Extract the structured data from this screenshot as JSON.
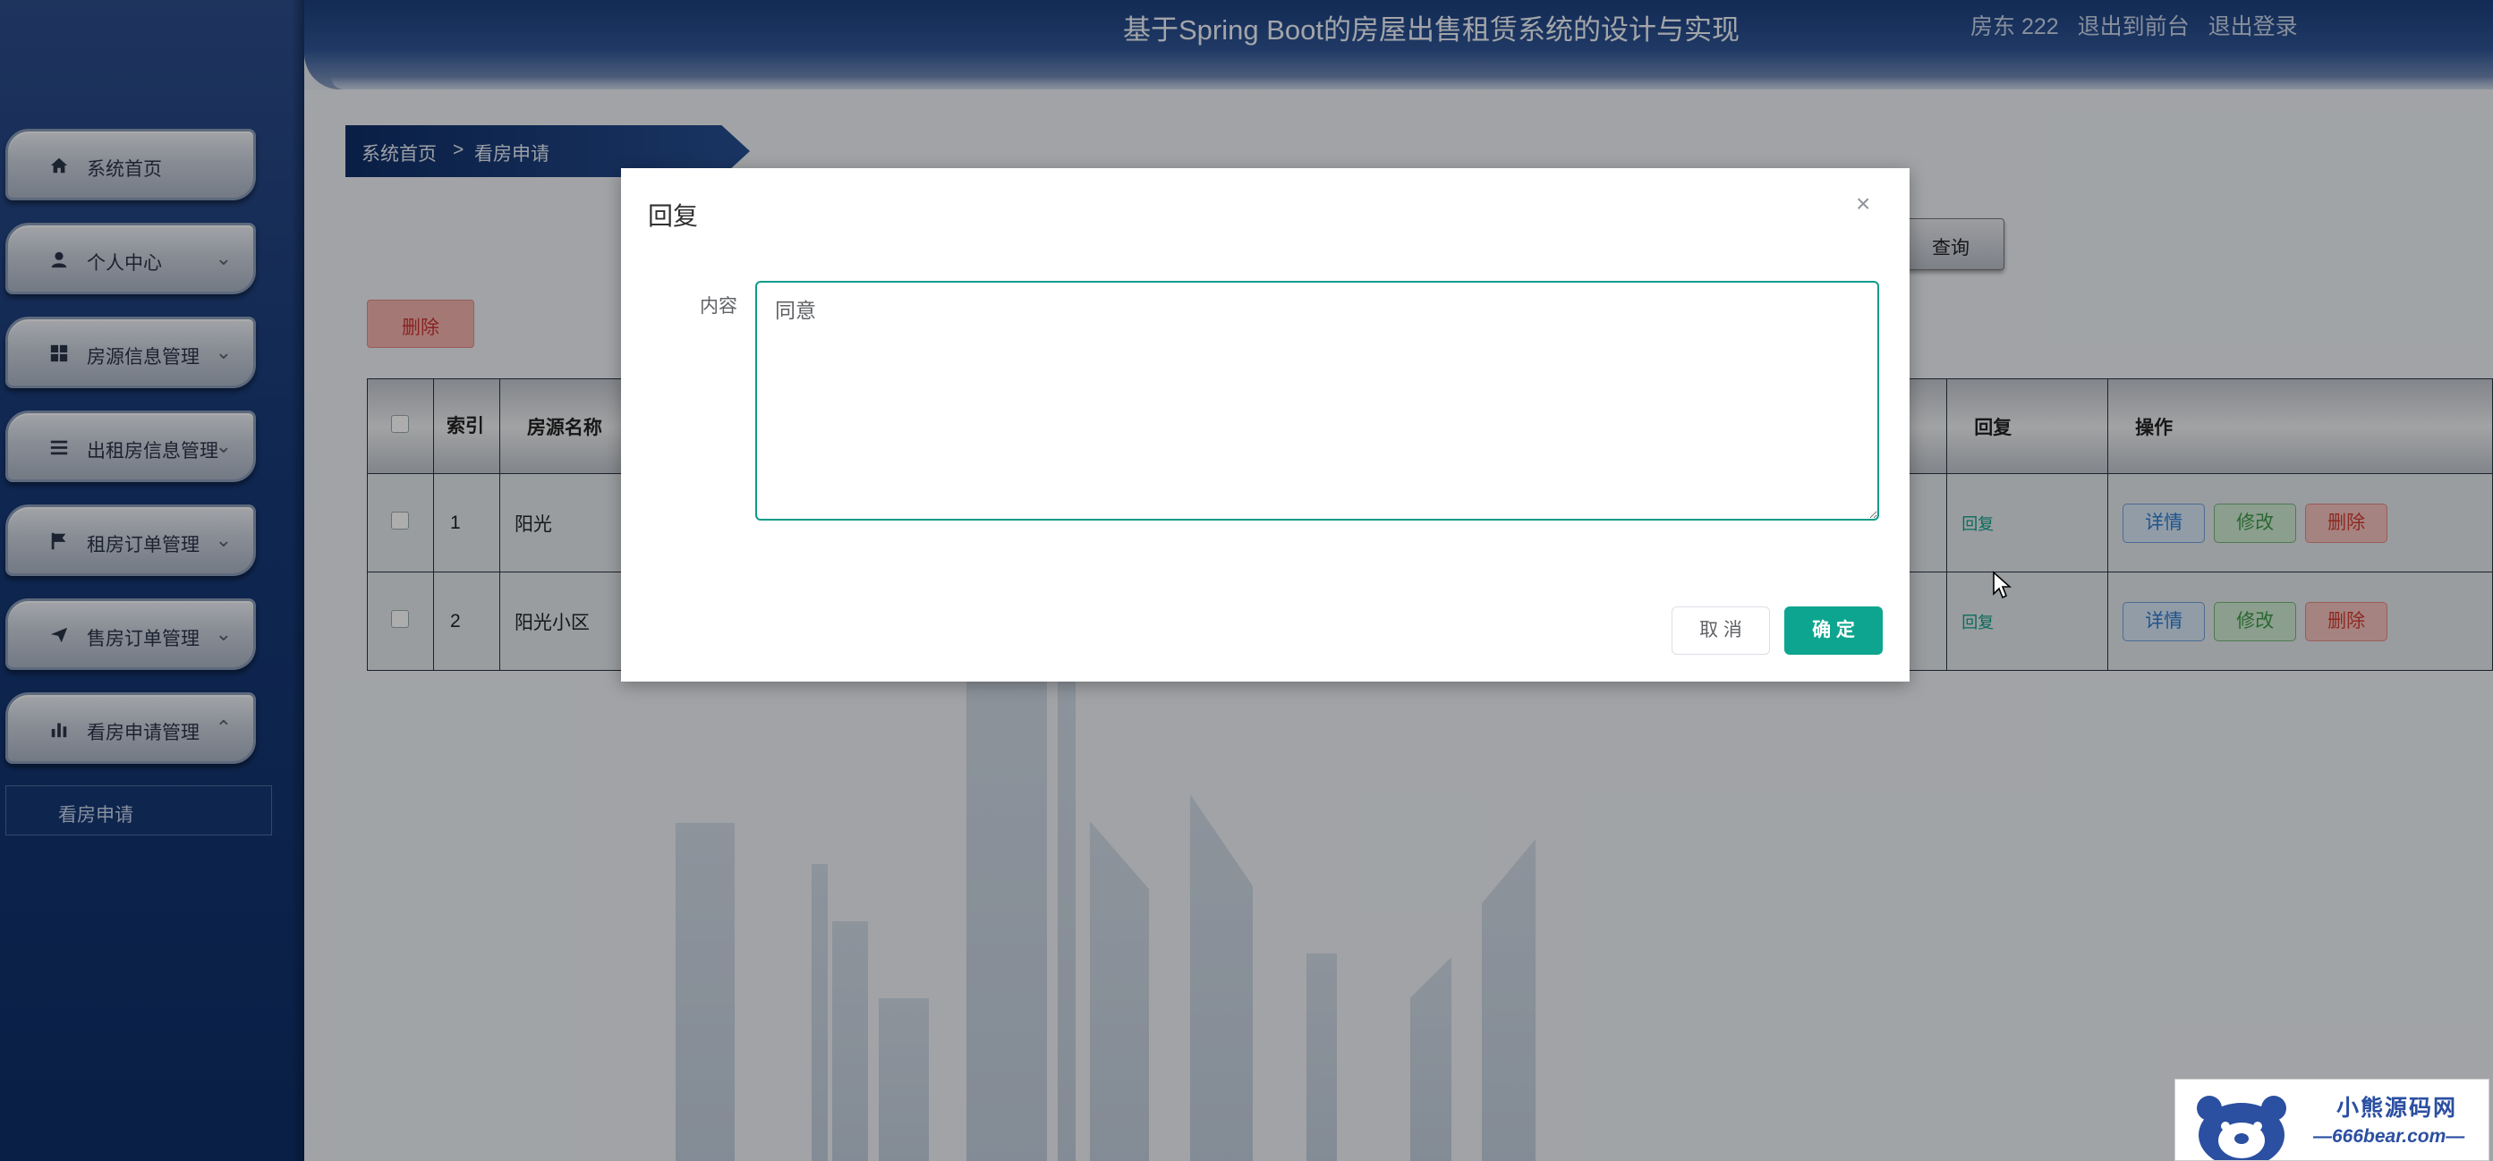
{
  "header": {
    "title": "基于Spring Boot的房屋出售租赁系统的设计与实现",
    "user": "房东 222",
    "frontend_link": "退出到前台",
    "logout_link": "退出登录"
  },
  "sidebar": {
    "items": [
      {
        "label": "系统首页",
        "icon": "home-icon"
      },
      {
        "label": "个人中心",
        "icon": "user-icon"
      },
      {
        "label": "房源信息管理",
        "icon": "grid-icon"
      },
      {
        "label": "出租房信息管理",
        "icon": "list-icon"
      },
      {
        "label": "租房订单管理",
        "icon": "flag-icon"
      },
      {
        "label": "售房订单管理",
        "icon": "send-icon"
      },
      {
        "label": "看房申请管理",
        "icon": "bar-chart-icon"
      }
    ],
    "sub_item": "看房申请"
  },
  "breadcrumb": {
    "home": "系统首页",
    "separator": ">",
    "current": "看房申请"
  },
  "toolbar": {
    "query_label": "查询",
    "delete_label": "删除"
  },
  "table": {
    "headers": {
      "index": "索引",
      "house_name": "房源名称",
      "reply": "回复",
      "actions": "操作"
    },
    "rows": [
      {
        "index": "1",
        "house_name": "阳光",
        "reply": "回复"
      },
      {
        "index": "2",
        "house_name": "阳光小区",
        "reply": "回复"
      }
    ],
    "row_buttons": {
      "detail": "详情",
      "edit": "修改",
      "delete": "删除"
    }
  },
  "dialog": {
    "title": "回复",
    "close": "×",
    "content_label": "内容",
    "content_value": "同意",
    "cancel_label": "取 消",
    "confirm_label": "确 定"
  },
  "watermark": {
    "cn": "小熊源码网",
    "en": "—666bear.com—"
  },
  "colors": {
    "accent": "#0da58f",
    "sidebar_bg": "#173a78",
    "danger": "#d23b33"
  }
}
